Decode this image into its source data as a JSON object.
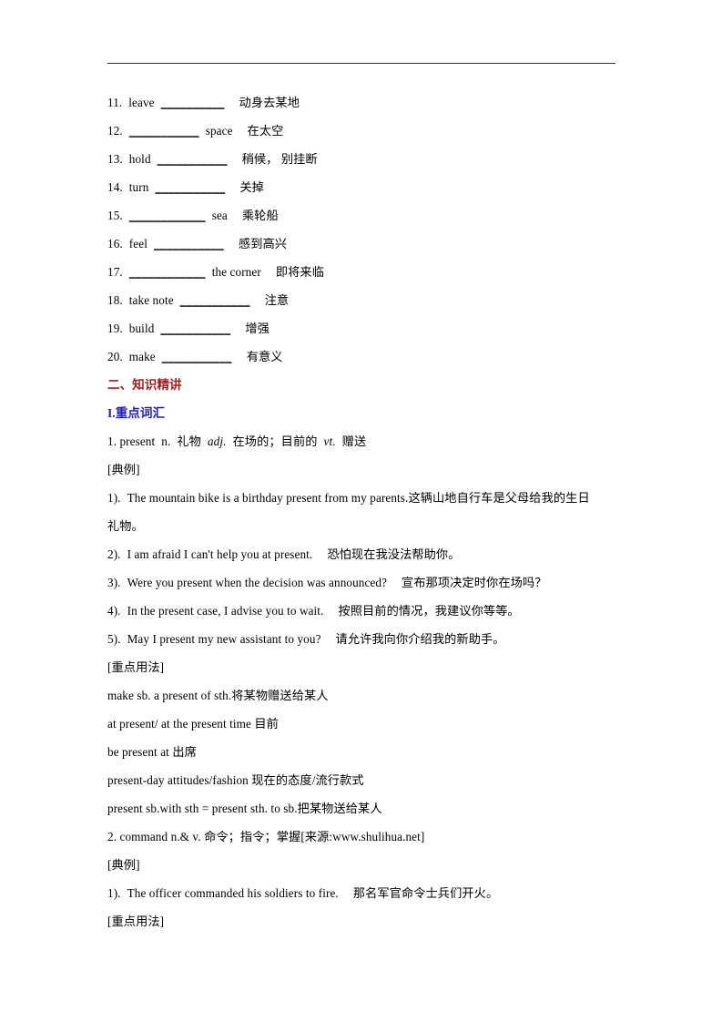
{
  "document": {
    "has_header_rule": true,
    "background_color": "#ffffff",
    "text_color": "#000000",
    "heading_red_color": "#9e1f1f",
    "heading_blue_color": "#2020b4"
  },
  "vocab_list": [
    {
      "number": "11.",
      "prefix": "leave",
      "blank": "__________",
      "suffix": "",
      "meaning": "动身去某地"
    },
    {
      "number": "12.",
      "prefix": "",
      "blank": "___________",
      "suffix": "space",
      "meaning": "在太空"
    },
    {
      "number": "13.",
      "prefix": "hold",
      "blank": "___________",
      "suffix": "",
      "meaning": "稍候， 别挂断"
    },
    {
      "number": "14.",
      "prefix": "turn",
      "blank": "___________",
      "suffix": "",
      "meaning": "关掉"
    },
    {
      "number": "15.",
      "prefix": "",
      "blank": "____________",
      "suffix": "sea",
      "meaning": "乘轮船"
    },
    {
      "number": "16.",
      "prefix": "feel",
      "blank": "___________",
      "suffix": "",
      "meaning": "感到高兴"
    },
    {
      "number": "17.",
      "prefix": "",
      "blank": "____________",
      "suffix": "the corner",
      "meaning": "即将来临"
    },
    {
      "number": "18.",
      "prefix": "take note",
      "blank": "___________",
      "suffix": "",
      "meaning": "注意"
    },
    {
      "number": "19.",
      "prefix": "build",
      "blank": "___________",
      "suffix": "",
      "meaning": "增强"
    },
    {
      "number": "20.",
      "prefix": "make",
      "blank": "___________",
      "suffix": "",
      "meaning": "有意义"
    }
  ],
  "section": {
    "heading": "二、知识精讲",
    "subheading": "I.重点词汇"
  },
  "entry_present": {
    "definition_number": "1. present",
    "pos_n": "n.",
    "gloss_n": "礼物",
    "pos_adj": "adj.",
    "gloss_adj": "在场的；目前的",
    "pos_vt": "vt.",
    "gloss_vt": "赠送",
    "examples_label": "[典例]",
    "examples": [
      {
        "number": "1).",
        "english": "The mountain bike is a birthday present from my parents.",
        "chinese": "这辆山地自行车是父母给我的生日",
        "chinese_cont": "礼物。"
      },
      {
        "number": "2).",
        "english": "I am afraid I can't help you at present.",
        "chinese": "恐怕现在我没法帮助你。",
        "chinese_cont": ""
      },
      {
        "number": "3).",
        "english": "Were you present when the decision was announced?",
        "chinese": "宣布那项决定时你在场吗？",
        "chinese_cont": ""
      },
      {
        "number": "4).",
        "english": "In the present case, I advise you to wait.",
        "chinese": "按照目前的情况，我建议你等等。",
        "chinese_cont": ""
      },
      {
        "number": "5).",
        "english": "May I present my new assistant to you?",
        "chinese": "请允许我向你介绍我的新助手。",
        "chinese_cont": ""
      }
    ],
    "usage_label": "[重点用法]",
    "usages": [
      "make sb. a present of sth.将某物赠送给某人",
      "at present/ at the present time 目前",
      "be present at 出席",
      "present-day attitudes/fashion 现在的态度/流行款式",
      "present sb.with sth = present sth. to sb.把某物送给某人"
    ]
  },
  "entry_command": {
    "definition_line": "2. command n.& v. 命令；指令；掌握[来源:www.shulihua.net]",
    "examples_label": "[典例]",
    "examples": [
      {
        "number": "1).",
        "english": "The officer commanded his soldiers to fire.",
        "chinese": "那名军官命令士兵们开火。"
      }
    ],
    "usage_label": "[重点用法]"
  }
}
